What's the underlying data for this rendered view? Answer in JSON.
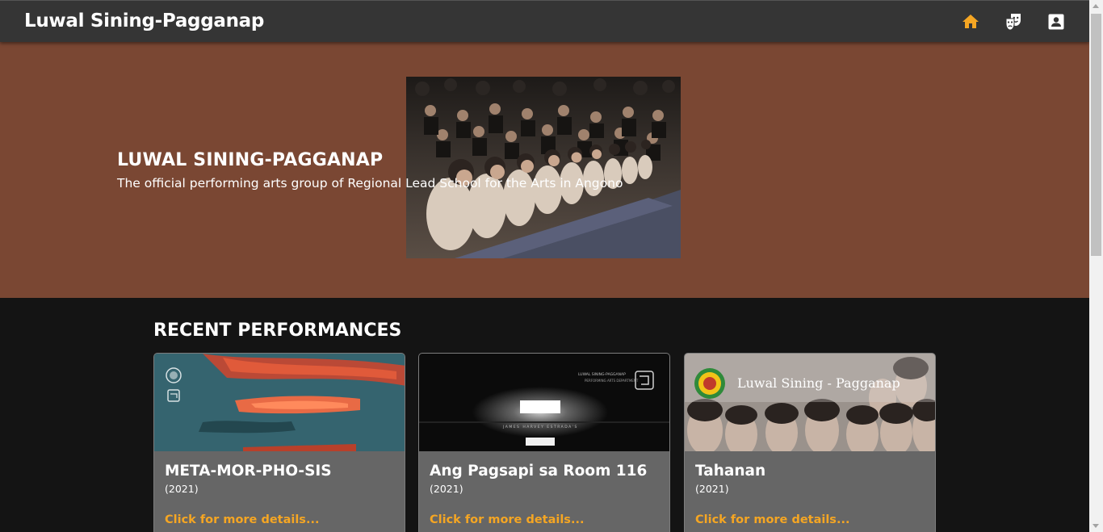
{
  "header": {
    "brand": "Luwal Sining-Pagganap",
    "nav": [
      {
        "icon": "home-icon",
        "active": true
      },
      {
        "icon": "theater-masks-icon",
        "active": false
      },
      {
        "icon": "contact-card-icon",
        "active": false
      }
    ]
  },
  "hero": {
    "title": "LUWAL SINING-PAGGANAP",
    "subtitle": "The official performing arts group of Regional Lead School for the Arts in Angono"
  },
  "recent": {
    "heading": "RECENT PERFORMANCES",
    "cards": [
      {
        "title": "META-MOR-PHO-SIS",
        "year": "(2021)",
        "link": "Click for more details..."
      },
      {
        "title": "Ang Pagsapi sa Room 116",
        "year": "(2021)",
        "link": "Click for more details...",
        "poster_small_text": "LUWAL SINING-PAGGANAP",
        "poster_small_text_2": "PERFORMING ARTS DEPARTMENT",
        "poster_credit": "JAMES HARVEY ESTRADA'S"
      },
      {
        "title": "Tahanan",
        "year": "(2021)",
        "link": "Click for more details...",
        "poster_banner": "Luwal Sining - Pagganap"
      }
    ]
  },
  "colors": {
    "topbar": "#353535",
    "hero_bg": "#7a4733",
    "page_bg": "#141414",
    "card_bg": "#666666",
    "accent": "#f5a623"
  }
}
